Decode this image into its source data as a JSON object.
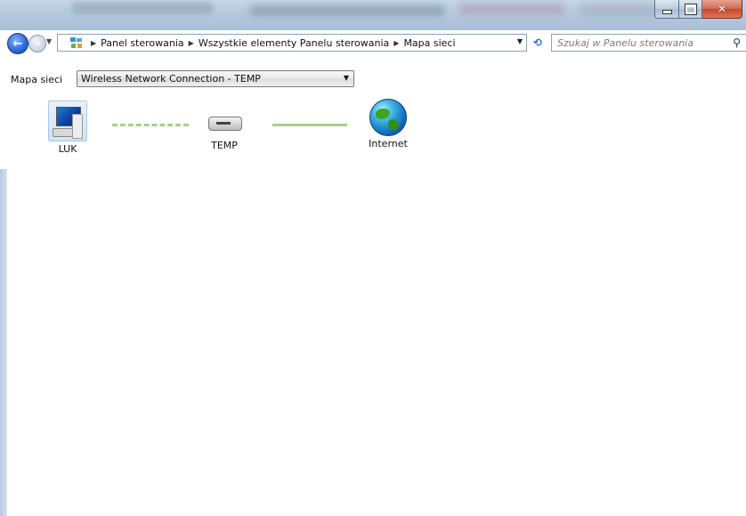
{
  "window": {
    "controls": {
      "minimize": "minimize",
      "maximize": "maximize",
      "close": "close"
    }
  },
  "nav": {
    "breadcrumbs": [
      "Panel sterowania",
      "Wszystkie elementy Panelu sterowania",
      "Mapa sieci"
    ],
    "search_placeholder": "Szukaj w Panelu sterowania"
  },
  "map": {
    "label": "Mapa sieci",
    "selected_connection": "Wireless Network Connection - TEMP",
    "nodes": [
      {
        "name": "LUK",
        "icon": "computer-icon"
      },
      {
        "name": "TEMP",
        "icon": "router-icon"
      },
      {
        "name": "Internet",
        "icon": "globe-icon"
      }
    ],
    "links": [
      {
        "from": "LUK",
        "to": "TEMP",
        "style": "dashed",
        "color": "#a8cf8c"
      },
      {
        "from": "TEMP",
        "to": "Internet",
        "style": "solid",
        "color": "#a8cf8c"
      }
    ]
  },
  "colors": {
    "accent": "#2a67d4",
    "link": "#a8cf8c",
    "close": "#c3472a"
  }
}
